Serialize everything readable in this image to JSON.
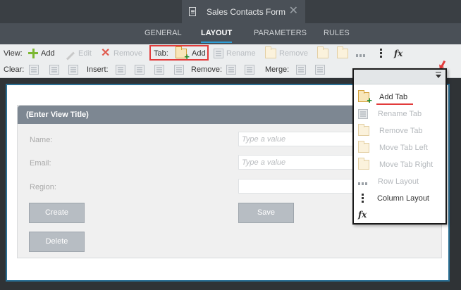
{
  "window": {
    "title": "Sales Contacts Form"
  },
  "nav": {
    "tabs": [
      "GENERAL",
      "LAYOUT",
      "PARAMETERS",
      "RULES"
    ],
    "active": "LAYOUT"
  },
  "toolbar": {
    "row1": {
      "view_label": "View:",
      "add": "Add",
      "edit": "Edit",
      "remove": "Remove",
      "tab_label": "Tab:",
      "tab_add": "Add",
      "tab_rename": "Rename",
      "tab_remove": "Remove"
    },
    "row2": {
      "clear_label": "Clear:",
      "insert_label": "Insert:",
      "remove_label": "Remove:",
      "merge_label": "Merge:"
    }
  },
  "form": {
    "title": "(Enter View Title)",
    "fields": [
      {
        "label": "Name:",
        "placeholder": "Type a value"
      },
      {
        "label": "Email:",
        "placeholder": "Type a value"
      },
      {
        "label": "Region:",
        "placeholder": ""
      }
    ],
    "buttons": {
      "create": "Create",
      "save": "Save",
      "delete": "Delete"
    }
  },
  "menu": {
    "items": [
      {
        "label": "Add Tab",
        "icon": "add-tab-icon",
        "enabled": true
      },
      {
        "label": "Rename Tab",
        "icon": "rename-tab-icon",
        "enabled": false
      },
      {
        "label": "Remove Tab",
        "icon": "remove-tab-icon",
        "enabled": false
      },
      {
        "label": "Move Tab Left",
        "icon": "move-tab-left-icon",
        "enabled": false
      },
      {
        "label": "Move Tab Right",
        "icon": "move-tab-right-icon",
        "enabled": false
      },
      {
        "label": "Row Layout",
        "icon": "row-layout-icon",
        "enabled": false
      },
      {
        "label": "Column Layout",
        "icon": "column-layout-icon",
        "enabled": true
      }
    ],
    "fx": "fx"
  },
  "colors": {
    "accent": "#2d9fd8",
    "highlight": "#e23b3b",
    "header": "#7d8792"
  }
}
